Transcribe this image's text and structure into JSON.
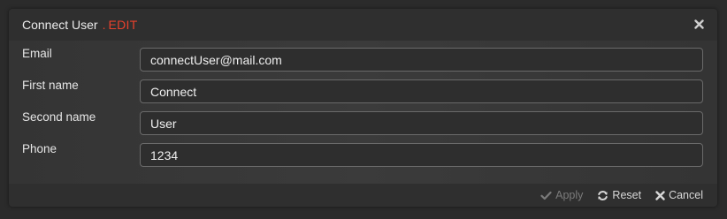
{
  "dialog": {
    "title": "Connect User",
    "title_separator": ".",
    "mode": "EDIT"
  },
  "fields": [
    {
      "label": "Email",
      "value": "connectUser@mail.com"
    },
    {
      "label": "First name",
      "value": "Connect"
    },
    {
      "label": "Second name",
      "value": "User"
    },
    {
      "label": "Phone",
      "value": "1234"
    }
  ],
  "footer": {
    "apply_label": "Apply",
    "reset_label": "Reset",
    "cancel_label": "Cancel"
  },
  "colors": {
    "accent": "#e8412c",
    "background": "#2b2b2b"
  },
  "icons": {
    "close": "close-icon",
    "apply": "check-icon",
    "reset": "refresh-icon",
    "cancel": "x-icon"
  }
}
